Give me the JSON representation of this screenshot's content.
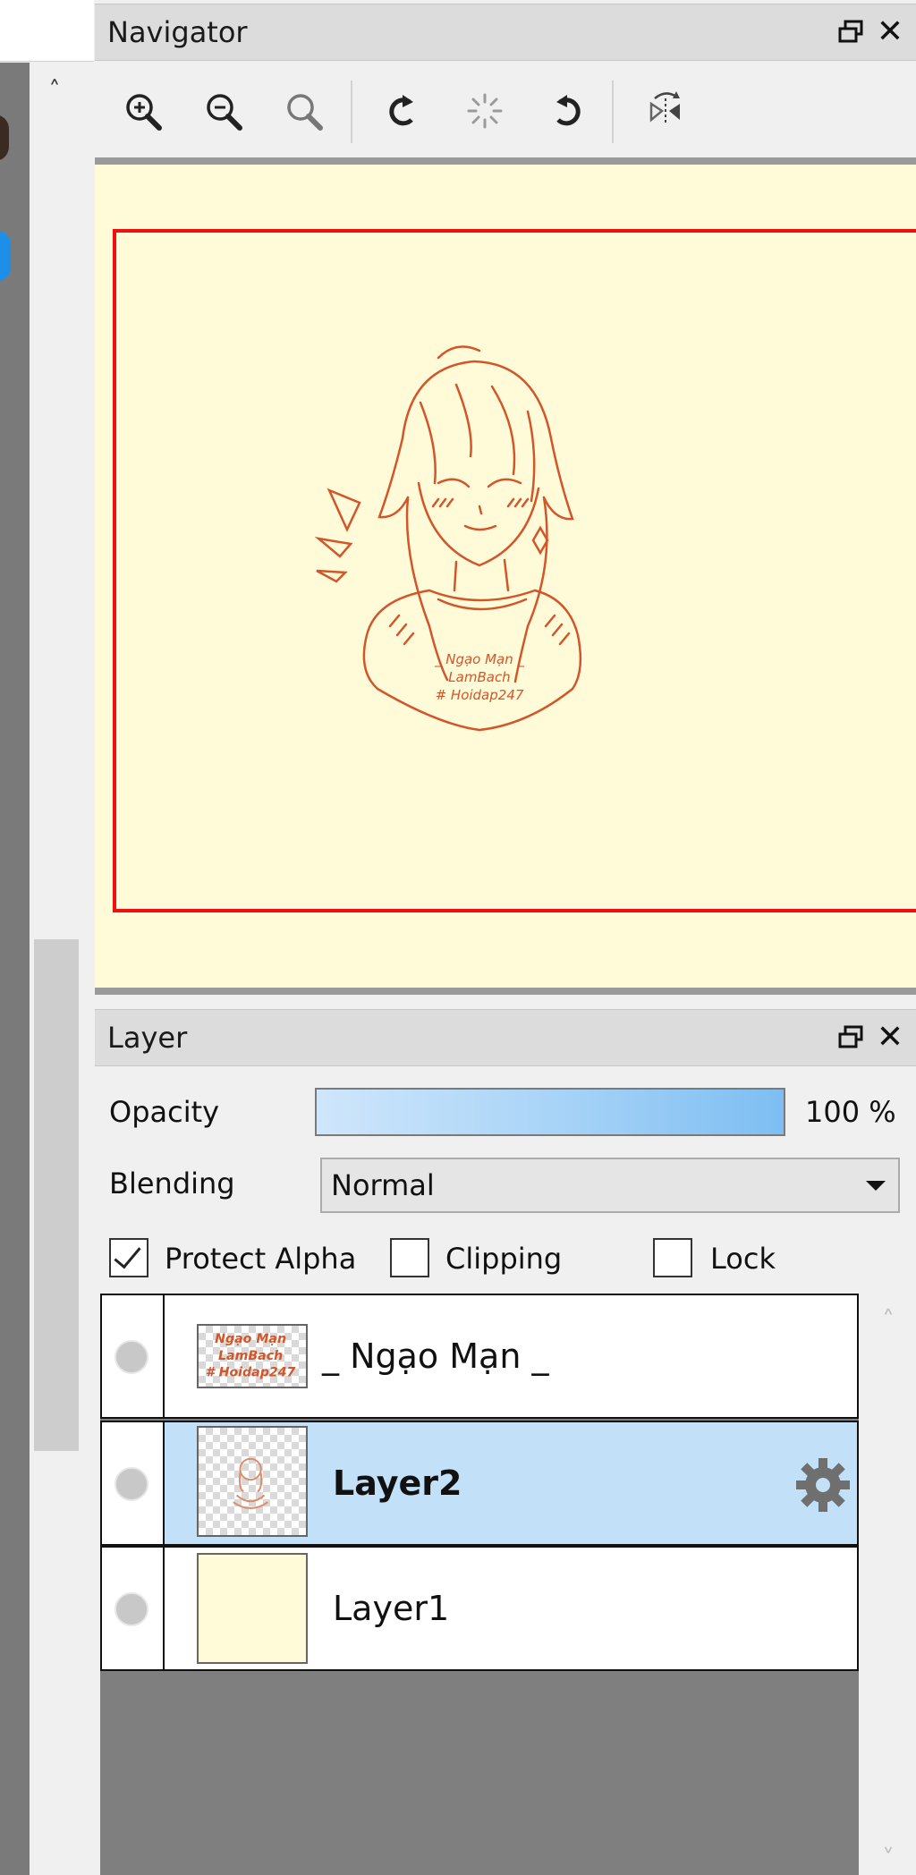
{
  "colors": {
    "accent": "#ee1111",
    "selection": "#c2e0f7",
    "canvas_bg": "#fffbd8",
    "sketch_line": "#d2562a"
  },
  "navigator": {
    "title": "Navigator",
    "float_icon": "restore-window-icon",
    "close_label": "✕",
    "left_scroll_up": "˄",
    "toolbar": [
      {
        "name": "zoom-in-icon"
      },
      {
        "name": "zoom-out-icon"
      },
      {
        "name": "zoom-reset-icon"
      },
      {
        "name": "rotate-left-icon"
      },
      {
        "name": "rotate-reset-icon"
      },
      {
        "name": "rotate-right-icon"
      },
      {
        "name": "flip-horizontal-icon"
      }
    ],
    "artwork_text": [
      "_ Ngạo Mạn _",
      "LamBach",
      "# Hoidap247"
    ]
  },
  "layer_panel": {
    "title": "Layer",
    "close_label": "✕",
    "opacity_label": "Opacity",
    "opacity_value": "100 %",
    "opacity_fraction": 1.0,
    "blending_label": "Blending",
    "blending_value": "Normal",
    "protect_alpha_label": "Protect Alpha",
    "protect_alpha_checked": true,
    "clipping_label": "Clipping",
    "clipping_checked": false,
    "lock_label": "Lock",
    "lock_checked": false,
    "layers": [
      {
        "name": "_ Ngạo Mạn _",
        "selected": false,
        "thumb_text": [
          "Ngạo Mạn",
          "LamBach",
          "# Hoidap247"
        ]
      },
      {
        "name": "Layer2",
        "selected": true
      },
      {
        "name": "Layer1",
        "selected": false
      }
    ],
    "scroll_up": "˄",
    "scroll_down": "˅"
  }
}
